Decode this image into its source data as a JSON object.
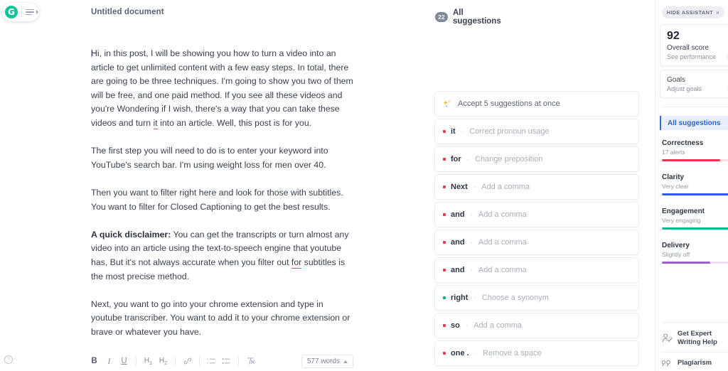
{
  "topbar": {
    "logo_letter": "G",
    "menu_icon": "hamburger-menu-icon",
    "doc_title": "Untitled document"
  },
  "document": {
    "paragraphs": [
      {
        "runs": [
          {
            "text": "Hi, in this post, I will be showing you how to turn a video into an article to get unlimited content with a few easy steps. In total, there are going to be three techniques. I'm going to show you two of them will be free, and one paid method. If you see all these videos and you're Wondering if I wish, there's a way that you can take these videos and turn ",
            "style": "normal"
          },
          {
            "text": "it",
            "style": "error"
          },
          {
            "text": " into an article. Well, this post is for you.",
            "style": "normal"
          }
        ]
      },
      {
        "runs": [
          {
            "text": "The first step you will need to do is to enter your keyword into YouTube's search bar. I'm using weight loss for men over 40.",
            "style": "normal"
          }
        ]
      },
      {
        "runs": [
          {
            "text": "Then you want to filter right here and look for those with subtitles. You want to filter for Closed Captioning to get the best results.",
            "style": "normal"
          }
        ]
      },
      {
        "runs": [
          {
            "text": "A quick disclaimer:",
            "style": "bold"
          },
          {
            "text": " You can get the transcripts or turn almost any video into an article using the text-to-speech engine that youtube has, But it's not always accurate when you filter out ",
            "style": "normal"
          },
          {
            "text": "for",
            "style": "error"
          },
          {
            "text": " subtitles is the most precise method.",
            "style": "normal"
          }
        ]
      },
      {
        "runs": [
          {
            "text": "Next, you want to go into your chrome extension and type in youtube transcriber. You want to add it to your chrome extension or brave or whatever you have.",
            "style": "normal"
          }
        ]
      }
    ]
  },
  "toolbar": {
    "help_icon": "help-question-icon",
    "bold_label": "B",
    "italic_label": "I",
    "underline_label": "U",
    "h1_label": "H",
    "h1_sub": "1",
    "h2_label": "H",
    "h2_sub": "2",
    "link_icon": "link-icon",
    "ordered_list_icon": "ordered-list-icon",
    "bullet_list_icon": "bullet-list-icon",
    "clear_format_icon": "clear-formatting-icon",
    "word_count": "577 words"
  },
  "suggestions": {
    "count_badge": "22",
    "header_label": "All suggestions",
    "accept_all": {
      "icon": "sparkle-icon",
      "label": "Accept 5 suggestions at once"
    },
    "items": [
      {
        "word": "it",
        "sep": "·",
        "action": "Correct pronoun usage",
        "dot": "red"
      },
      {
        "word": "for",
        "sep": "·",
        "action": "Change preposition",
        "dot": "red"
      },
      {
        "word": "Next",
        "sep": "·",
        "action": "Add a comma",
        "dot": "red"
      },
      {
        "word": "and",
        "sep": "·",
        "action": "Add a comma",
        "dot": "red"
      },
      {
        "word": "and",
        "sep": "·",
        "action": "Add a comma",
        "dot": "red"
      },
      {
        "word": "and",
        "sep": "·",
        "action": "Add a comma",
        "dot": "red"
      },
      {
        "word": "right",
        "sep": "·",
        "action": "Choose a synonym",
        "dot": "green"
      },
      {
        "word": "so",
        "sep": "·",
        "action": "Add a comma",
        "dot": "red"
      },
      {
        "word": "one .",
        "sep": "·",
        "action": "Remove a space",
        "dot": "red"
      }
    ]
  },
  "assistant": {
    "hide_label": "HIDE ASSISTANT",
    "hide_chevrons": "»",
    "score": {
      "value": "92",
      "label": "Overall score",
      "link": "See performance",
      "chevron": "›"
    },
    "goals": {
      "title": "Goals",
      "link": "Adjust goals",
      "chevron": "›"
    },
    "tab_all_suggestions": "All suggestions",
    "metrics": [
      {
        "name": "Correctness",
        "sub": "17 alerts",
        "pct": 86,
        "color": "#e8384f",
        "track": "#fbdde2"
      },
      {
        "name": "Clarity",
        "sub": "Very clear",
        "pct": 100,
        "color": "#2f5fe0",
        "track": "#dde5fb"
      },
      {
        "name": "Engagement",
        "sub": "Very engaging",
        "pct": 100,
        "color": "#14b588",
        "track": "#d5f3ea"
      },
      {
        "name": "Delivery",
        "sub": "Slightly off",
        "pct": 72,
        "color": "#9b5fd0",
        "track": "#ecdff7"
      }
    ],
    "footer": [
      {
        "icon": "expert-writer-icon",
        "line1": "Get Expert",
        "line2": "Writing Help"
      },
      {
        "icon": "plagiarism-quotes-icon",
        "line1": "Plagiarism",
        "line2": ""
      }
    ]
  }
}
